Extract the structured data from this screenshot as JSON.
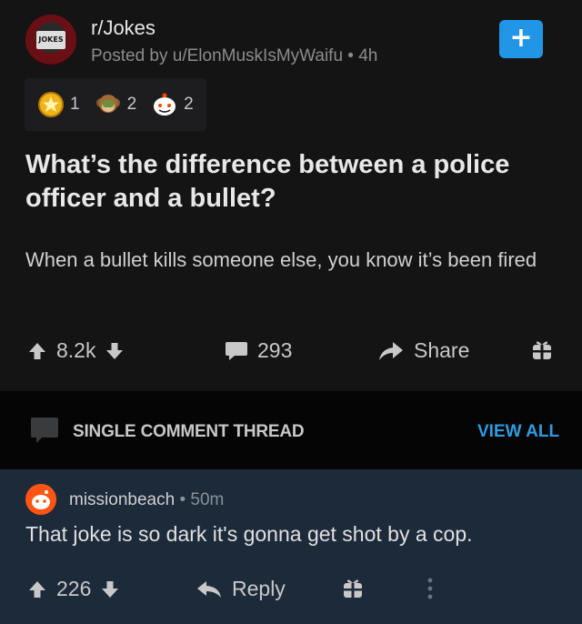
{
  "post": {
    "subreddit": "r/Jokes",
    "posted_by": "Posted by u/ElonMuskIsMyWaifu",
    "age": "4h",
    "subreddit_icon_text": "JOKES",
    "join_label": "+",
    "awards": [
      {
        "icon": "gold-award-icon",
        "count": "1"
      },
      {
        "icon": "monkey-award-icon",
        "count": "2"
      },
      {
        "icon": "wholesome-award-icon",
        "count": "2"
      }
    ],
    "title": "What’s the difference between a police officer and a bullet?",
    "body": "When a bullet kills someone else, you know it’s been fired",
    "score": "8.2k",
    "comments": "293",
    "share": "Share"
  },
  "thread": {
    "label": "SINGLE COMMENT THREAD",
    "view_all": "VIEW ALL"
  },
  "comment": {
    "user": "missionbeach",
    "age": "50m",
    "text": "That joke is so dark it's gonna get shot by a cop.",
    "score": "226",
    "reply": "Reply"
  },
  "colors": {
    "accent": "#2196e6",
    "view_all": "#2f9be0",
    "comment_bg": "#1d2a3a"
  }
}
